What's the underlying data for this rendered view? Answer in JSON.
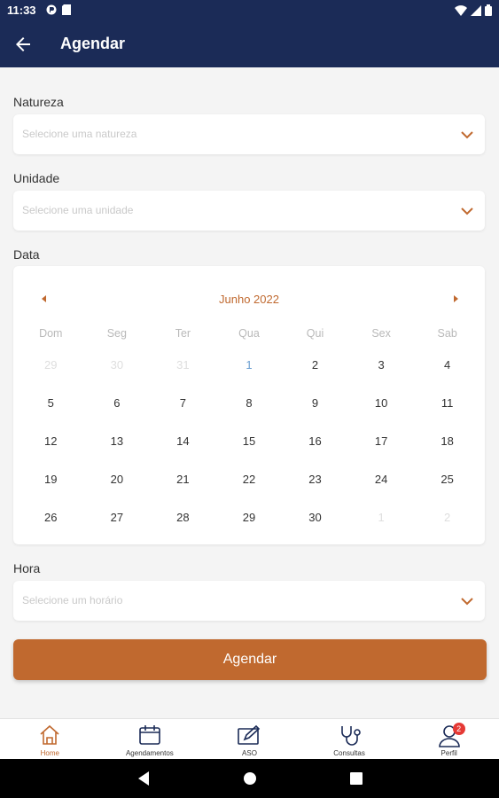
{
  "status_bar": {
    "time": "11:33"
  },
  "app_bar": {
    "title": "Agendar"
  },
  "form": {
    "natureza": {
      "label": "Natureza",
      "placeholder": "Selecione uma natureza"
    },
    "unidade": {
      "label": "Unidade",
      "placeholder": "Selecione uma unidade"
    },
    "data": {
      "label": "Data"
    },
    "hora": {
      "label": "Hora",
      "placeholder": "Selecione um horário"
    }
  },
  "calendar": {
    "month_label": "Junho 2022",
    "weekdays": [
      "Dom",
      "Seg",
      "Ter",
      "Qua",
      "Qui",
      "Sex",
      "Sab"
    ],
    "weeks": [
      [
        "29",
        "30",
        "31",
        "1",
        "2",
        "3",
        "4"
      ],
      [
        "5",
        "6",
        "7",
        "8",
        "9",
        "10",
        "11"
      ],
      [
        "12",
        "13",
        "14",
        "15",
        "16",
        "17",
        "18"
      ],
      [
        "19",
        "20",
        "21",
        "22",
        "23",
        "24",
        "25"
      ],
      [
        "26",
        "27",
        "28",
        "29",
        "30",
        "1",
        "2"
      ]
    ],
    "outside_month": [
      [
        0,
        0
      ],
      [
        0,
        1
      ],
      [
        0,
        2
      ],
      [
        4,
        5
      ],
      [
        4,
        6
      ]
    ],
    "highlighted": [
      [
        0,
        3
      ]
    ]
  },
  "submit_label": "Agendar",
  "bottom_nav": {
    "items": [
      {
        "label": "Home",
        "icon": "home-icon",
        "active": true
      },
      {
        "label": "Agendamentos",
        "icon": "calendar-icon",
        "active": false
      },
      {
        "label": "ASO",
        "icon": "document-edit-icon",
        "active": false
      },
      {
        "label": "Consultas",
        "icon": "stethoscope-icon",
        "active": false
      },
      {
        "label": "Perfil",
        "icon": "profile-icon",
        "active": false,
        "badge": "2"
      }
    ]
  },
  "colors": {
    "header": "#1b2b57",
    "accent": "#c0692f",
    "today": "#6b9fd1",
    "badge": "#e53935"
  }
}
